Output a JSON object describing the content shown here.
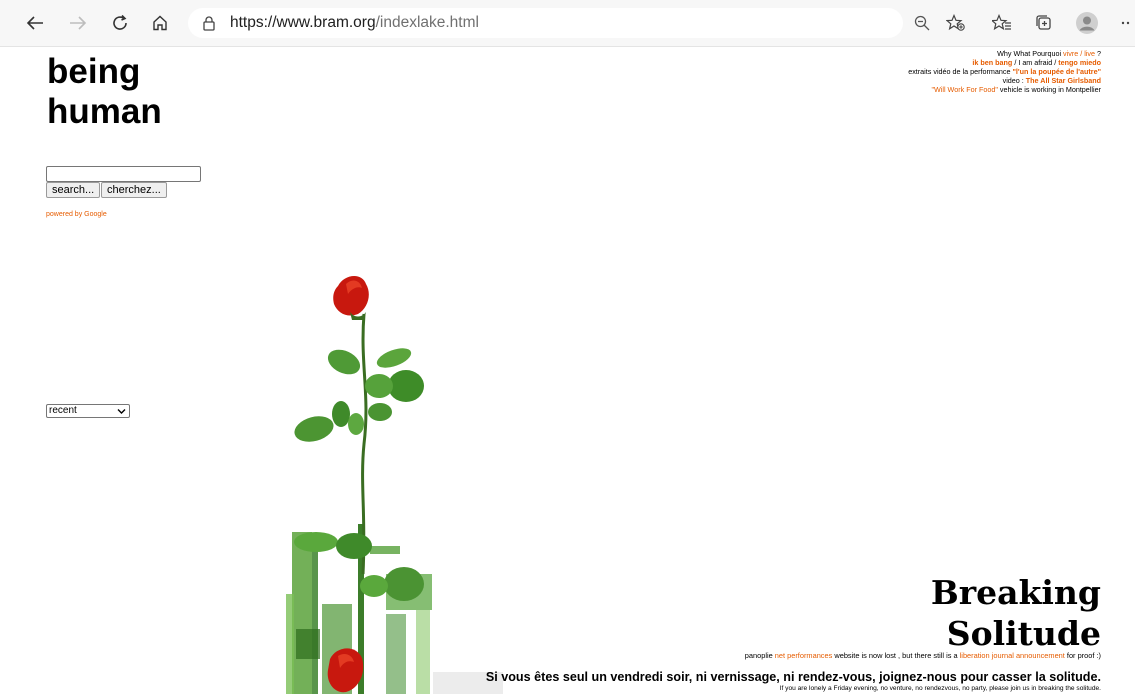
{
  "browser": {
    "url_host": "https://www.bram.org",
    "url_path": "/indexlake.html",
    "icons": [
      "back-arrow-icon",
      "forward-arrow-icon",
      "refresh-icon",
      "home-icon",
      "lock-icon",
      "zoom-out-icon",
      "add-favorite-icon",
      "favorites-icon",
      "collections-icon",
      "profile-icon",
      "more-icon"
    ]
  },
  "site": {
    "title_line1": "being",
    "title_line2": "human"
  },
  "search": {
    "input_value": "",
    "search_label": "search...",
    "cherchez_label": "cherchez...",
    "powered_by": "powered by Google"
  },
  "archive_select": {
    "selected": "recent"
  },
  "top_links": {
    "line1_prefix": "Why What Pourquoi ",
    "line1_link": "vivre / live",
    "line1_suffix": " ?",
    "line2_link1": "ik ben bang",
    "line2_mid": " / I am afraid / ",
    "line2_link2": "tengo miedo",
    "line3_prefix": "extraits vidéo de la performance ",
    "line3_link": "\"l'un la poupée de l'autre\"",
    "line4_prefix": "video : ",
    "line4_link": "The All Star Girlsband",
    "line5_link": "\"Will Work For Food\"",
    "line5_suffix": " vehicle is working in Montpellier"
  },
  "feature": {
    "heading_line1": "Breaking",
    "heading_line2": "Solitude",
    "panoplie_prefix": "panoplie ",
    "panoplie_link": "net performances",
    "panoplie_mid": " website is now lost , but there still is a ",
    "panoplie_link2": "liberation journal announcement",
    "panoplie_suffix": " for proof :)",
    "french_line": "Si vous êtes seul un vendredi soir, ni vernissage, ni rendez-vous, joignez-nous pour casser la solitude.",
    "english_line": "If you are lonely a Friday evening, no venture, no rendezvous, no party, please join us in breaking the solitude."
  },
  "colors": {
    "link_orange": "#e65c00",
    "rose_red": "#c8180e",
    "leaf_green": "#3f8f2a"
  }
}
